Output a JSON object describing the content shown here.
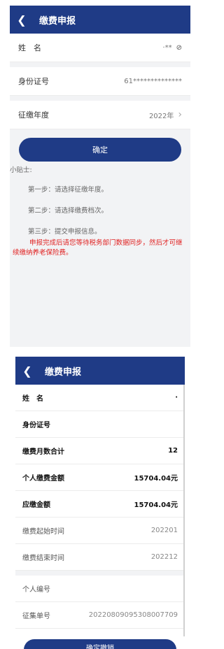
{
  "screen1": {
    "nav": {
      "back_icon": "chevron-left-icon",
      "title": "缴费申报"
    },
    "fields": [
      {
        "label": "姓　名",
        "value": "·**"
      },
      {
        "label": "身份证号",
        "value": "61**************"
      },
      {
        "label": "征缴年度",
        "value": "2022年"
      }
    ],
    "confirm_button": "确定",
    "tips": {
      "title": "小贴士:",
      "step1": "第一步：请选择征缴年度。",
      "step2": "第二步：请选择缴费档次。",
      "step3": "第三步：提交申报信息。",
      "warning": "申报完成后请您等待税务部门数据同步，然后才可继续缴纳养老保险费。"
    }
  },
  "screen2": {
    "nav": {
      "title": "缴费申报"
    },
    "rows": [
      {
        "label": "姓　名",
        "value": "·"
      },
      {
        "label": "身份证号",
        "value": ""
      },
      {
        "label": "缴费月数合计",
        "value": "12"
      },
      {
        "label": "个人缴费金额",
        "value": "15704.04元"
      },
      {
        "label": "应缴金额",
        "value": "15704.04元"
      },
      {
        "label": "缴费起始时间",
        "value": "202201"
      },
      {
        "label": "缴费结束时间",
        "value": "202212"
      },
      {
        "label": "个人编号",
        "value": ""
      },
      {
        "label": "征集单号",
        "value": "202208090953080077​09"
      }
    ],
    "cancel_button": "确定撤销"
  }
}
